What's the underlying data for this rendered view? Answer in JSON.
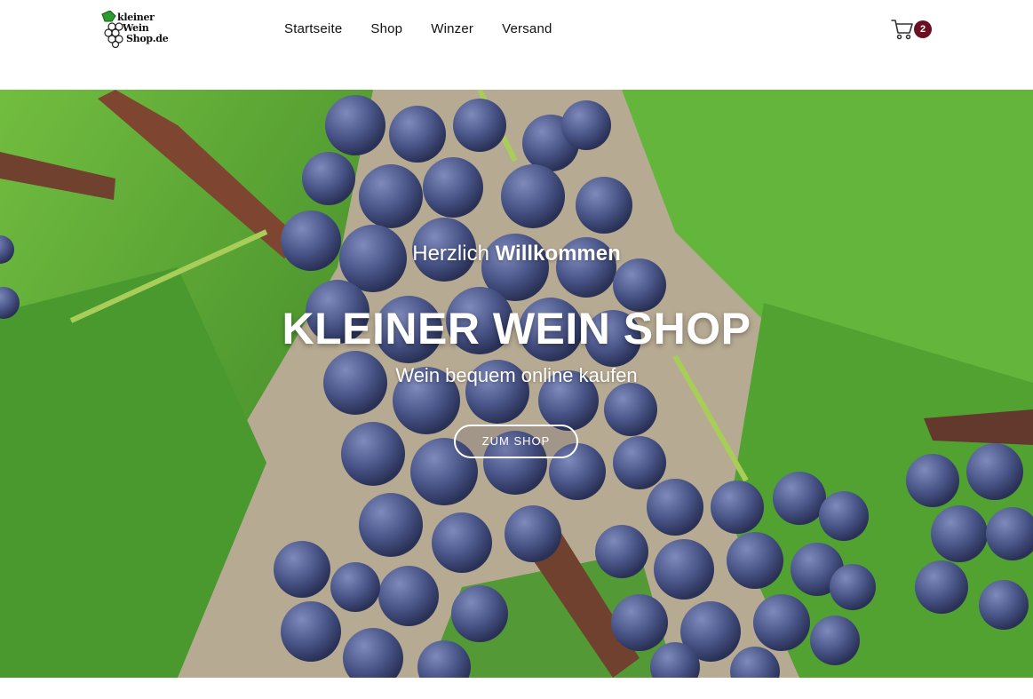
{
  "logo": {
    "text_lines": [
      "kleiner",
      "Wein",
      "Shop.de"
    ]
  },
  "nav": {
    "items": [
      {
        "label": "Startseite"
      },
      {
        "label": "Shop"
      },
      {
        "label": "Winzer"
      },
      {
        "label": "Versand"
      }
    ]
  },
  "cart": {
    "icon": "cart-icon",
    "count": "2",
    "badge_color": "#6b0f22"
  },
  "hero": {
    "greeting_prefix": "Herzlich",
    "greeting_bold": "Willkommen",
    "title": "KLEINER WEIN SHOP",
    "subtitle": "Wein bequem online kaufen",
    "cta_label": "ZUM SHOP"
  },
  "colors": {
    "accent": "#6b0f22",
    "leaf": "#6fbd3a",
    "grape": "#4a5589"
  }
}
